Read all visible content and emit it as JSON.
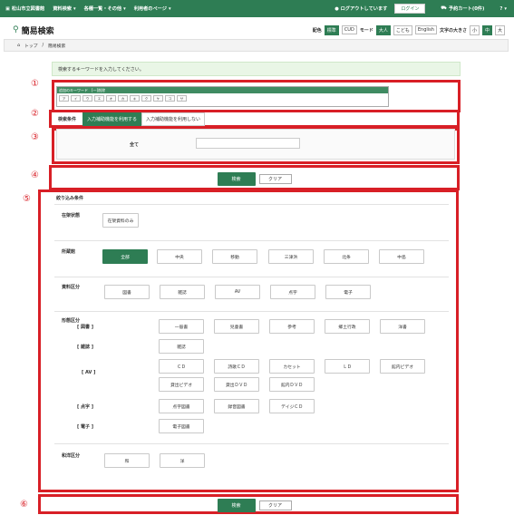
{
  "topbar": {
    "logo": "松山市立図書館",
    "menu": [
      "資料検索",
      "各種一覧・その他",
      "利用者のページ"
    ],
    "logout": "ログアウトしています",
    "login": "ログイン",
    "cart": "予約カート(0件)",
    "help": "?"
  },
  "title": "簡易検索",
  "options": {
    "color_label": "配色",
    "color_std": "標準",
    "cud": "CUD",
    "mode_label": "モード",
    "adult": "大人",
    "kids": "こども",
    "english": "English",
    "size_label": "文字の大きさ",
    "small": "小",
    "mid": "中",
    "large": "大"
  },
  "breadcrumb": {
    "home": "トップ",
    "sep": "/",
    "current": "簡易検索"
  },
  "message": "検索するキーワードを入力してください。",
  "keyboard": {
    "header": "追加のキーワード　[一]削除",
    "keys": [
      "ア",
      "イ",
      "ウ",
      "エ",
      "オ",
      "カ",
      "キ",
      "ク",
      "ケ",
      "コ",
      "サ"
    ]
  },
  "tabs": {
    "label": "検索条件",
    "on": "入力補助機能を利用する",
    "off": "入力補助機能を利用しない"
  },
  "field": {
    "label": "全て",
    "value": ""
  },
  "buttons": {
    "search": "検索",
    "clear": "クリア"
  },
  "filter": {
    "title": "絞り込み条件",
    "stock": {
      "label": "在架状態",
      "option": "在架資料のみ"
    },
    "branch": {
      "label": "所蔵館",
      "options": [
        "全部",
        "中央",
        "移動",
        "三津浜",
        "北条",
        "中島"
      ]
    },
    "type": {
      "label": "資料区分",
      "options": [
        "図書",
        "雑誌",
        "AV",
        "点字",
        "電子"
      ]
    },
    "form": {
      "label": "形態区分",
      "book": {
        "label": "[ 図書 ]",
        "options": [
          "一般書",
          "児童書",
          "参考",
          "郷土行政",
          "洋書"
        ]
      },
      "mag": {
        "label": "[ 雑誌 ]",
        "options": [
          "雑誌"
        ]
      },
      "av": {
        "label": "[ AV ]",
        "options": [
          "ＣＤ",
          "詩歌ＣＤ",
          "カセット",
          "ＬＤ",
          "館内ビデオ",
          "貸出ビデオ",
          "貸出ＤＶＤ",
          "館内ＤＶＤ"
        ]
      },
      "braille": {
        "label": "[ 点字 ]",
        "options": [
          "点字図書",
          "録音図書",
          "デイジＣＤ"
        ]
      },
      "elec": {
        "label": "[ 電子 ]",
        "options": [
          "電子図書"
        ]
      }
    },
    "lang": {
      "label": "和洋区分",
      "options": [
        "和",
        "洋"
      ]
    }
  },
  "annotations": [
    "①",
    "②",
    "③",
    "④",
    "⑤",
    "⑥"
  ],
  "colors": {
    "brand": "#2e7d54",
    "highlight": "#d81f26"
  }
}
